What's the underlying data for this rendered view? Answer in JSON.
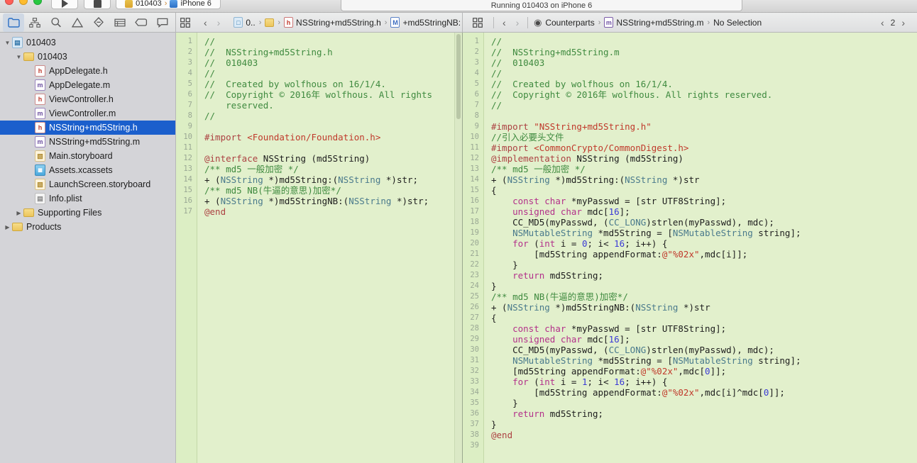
{
  "titlebar": {
    "run_label": "Run",
    "stop_label": "Stop",
    "scheme_name": "010403",
    "scheme_separator": "›",
    "device_name": "iPhone 6",
    "status_text": "Running 010403 on iPhone 6"
  },
  "navigator_icons": [
    {
      "name": "project-navigator-icon",
      "selected": true
    },
    {
      "name": "symbol-navigator-icon",
      "selected": false
    },
    {
      "name": "find-navigator-icon",
      "selected": false
    },
    {
      "name": "issue-navigator-icon",
      "selected": false
    },
    {
      "name": "test-navigator-icon",
      "selected": false
    },
    {
      "name": "debug-navigator-icon",
      "selected": false
    },
    {
      "name": "breakpoint-navigator-icon",
      "selected": false
    },
    {
      "name": "report-navigator-icon",
      "selected": false
    }
  ],
  "left_jumpbar": {
    "related_items_label": "Related Items",
    "back_label": "‹",
    "forward_label": "›",
    "crumbs": [
      {
        "label": "0..",
        "icon": "project-icon"
      },
      {
        "label": "",
        "icon": "folder-icon"
      },
      {
        "label": "NSString+md5String.h",
        "icon": "header-file-icon"
      },
      {
        "label": "+md5StringNB:",
        "icon": "method-icon"
      }
    ]
  },
  "right_jumpbar": {
    "back_label": "‹",
    "forward_label": "›",
    "crumbs": [
      {
        "label": "Counterparts",
        "icon": "counterparts-icon"
      },
      {
        "label": "NSString+md5String.m",
        "icon": "implementation-file-icon"
      },
      {
        "label": "No Selection",
        "icon": ""
      }
    ],
    "pager": {
      "prev": "‹",
      "count": "2",
      "next": "›"
    }
  },
  "sidebar": {
    "items": [
      {
        "label": "010403",
        "icon": "project-icon",
        "indent": 0,
        "twisty": "open",
        "selected": false
      },
      {
        "label": "010403",
        "icon": "folder-icon",
        "indent": 1,
        "twisty": "open",
        "selected": false
      },
      {
        "label": "AppDelegate.h",
        "icon": "header-file-icon",
        "indent": 2,
        "twisty": "none",
        "selected": false
      },
      {
        "label": "AppDelegate.m",
        "icon": "implementation-file-icon",
        "indent": 2,
        "twisty": "none",
        "selected": false
      },
      {
        "label": "ViewController.h",
        "icon": "header-file-icon",
        "indent": 2,
        "twisty": "none",
        "selected": false
      },
      {
        "label": "ViewController.m",
        "icon": "implementation-file-icon",
        "indent": 2,
        "twisty": "none",
        "selected": false
      },
      {
        "label": "NSString+md5String.h",
        "icon": "header-file-icon",
        "indent": 2,
        "twisty": "none",
        "selected": true
      },
      {
        "label": "NSString+md5String.m",
        "icon": "implementation-file-icon",
        "indent": 2,
        "twisty": "none",
        "selected": false
      },
      {
        "label": "Main.storyboard",
        "icon": "storyboard-icon",
        "indent": 2,
        "twisty": "none",
        "selected": false
      },
      {
        "label": "Assets.xcassets",
        "icon": "assets-icon",
        "indent": 2,
        "twisty": "none",
        "selected": false
      },
      {
        "label": "LaunchScreen.storyboard",
        "icon": "storyboard-icon",
        "indent": 2,
        "twisty": "none",
        "selected": false
      },
      {
        "label": "Info.plist",
        "icon": "plist-icon",
        "indent": 2,
        "twisty": "none",
        "selected": false
      },
      {
        "label": "Supporting Files",
        "icon": "folder-icon",
        "indent": 1,
        "twisty": "closed",
        "selected": false
      },
      {
        "label": "Products",
        "icon": "folder-icon",
        "indent": 0,
        "twisty": "closed",
        "selected": false
      }
    ]
  },
  "left_editor": {
    "file": "NSString+md5String.h",
    "line_count": 17,
    "lines": [
      {
        "n": 1,
        "tokens": [
          {
            "t": "//",
            "c": "c"
          }
        ]
      },
      {
        "n": 2,
        "tokens": [
          {
            "t": "//  NSString+md5String.h",
            "c": "c"
          }
        ]
      },
      {
        "n": 3,
        "tokens": [
          {
            "t": "//  010403",
            "c": "c"
          }
        ]
      },
      {
        "n": 4,
        "tokens": [
          {
            "t": "//",
            "c": "c"
          }
        ]
      },
      {
        "n": 5,
        "tokens": [
          {
            "t": "//  Created by wolfhous on 16/1/4.",
            "c": "c"
          }
        ]
      },
      {
        "n": 6,
        "wrapped": true,
        "tokens": [
          {
            "t": "//  Copyright © 2016年 wolfhous. All rights\n    reserved.",
            "c": "c"
          }
        ]
      },
      {
        "n": 7,
        "tokens": [
          {
            "t": "//",
            "c": "c"
          }
        ]
      },
      {
        "n": 8,
        "tokens": [
          {
            "t": "",
            "c": "pl"
          }
        ]
      },
      {
        "n": 9,
        "tokens": [
          {
            "t": "#import ",
            "c": "pre"
          },
          {
            "t": "<Foundation/Foundation.h>",
            "c": "str"
          }
        ]
      },
      {
        "n": 10,
        "tokens": [
          {
            "t": "",
            "c": "pl"
          }
        ]
      },
      {
        "n": 11,
        "tokens": [
          {
            "t": "@interface ",
            "c": "pre"
          },
          {
            "t": "NSString ",
            "c": "pl"
          },
          {
            "t": "(md5String)",
            "c": "pl"
          }
        ]
      },
      {
        "n": 12,
        "tokens": [
          {
            "t": "/** md5 一般加密 */",
            "c": "c"
          }
        ]
      },
      {
        "n": 13,
        "tokens": [
          {
            "t": "+ (",
            "c": "pl"
          },
          {
            "t": "NSString",
            "c": "ty"
          },
          {
            "t": " *)md5String:(",
            "c": "pl"
          },
          {
            "t": "NSString",
            "c": "ty"
          },
          {
            "t": " *)str;",
            "c": "pl"
          }
        ]
      },
      {
        "n": 14,
        "tokens": [
          {
            "t": "/** md5 NB(牛逼的意思)加密*/",
            "c": "c"
          }
        ]
      },
      {
        "n": 15,
        "tokens": [
          {
            "t": "+ (",
            "c": "pl"
          },
          {
            "t": "NSString",
            "c": "ty"
          },
          {
            "t": " *)md5StringNB:(",
            "c": "pl"
          },
          {
            "t": "NSString",
            "c": "ty"
          },
          {
            "t": " *)str;",
            "c": "pl"
          }
        ]
      },
      {
        "n": 16,
        "tokens": [
          {
            "t": "@end",
            "c": "pre"
          }
        ]
      },
      {
        "n": 17,
        "tokens": [
          {
            "t": "",
            "c": "pl"
          }
        ]
      }
    ]
  },
  "right_editor": {
    "file": "NSString+md5String.m",
    "line_count": 39,
    "lines": [
      {
        "n": 1,
        "tokens": [
          {
            "t": "//",
            "c": "c"
          }
        ]
      },
      {
        "n": 2,
        "tokens": [
          {
            "t": "//  NSString+md5String.m",
            "c": "c"
          }
        ]
      },
      {
        "n": 3,
        "tokens": [
          {
            "t": "//  010403",
            "c": "c"
          }
        ]
      },
      {
        "n": 4,
        "tokens": [
          {
            "t": "//",
            "c": "c"
          }
        ]
      },
      {
        "n": 5,
        "tokens": [
          {
            "t": "//  Created by wolfhous on 16/1/4.",
            "c": "c"
          }
        ]
      },
      {
        "n": 6,
        "tokens": [
          {
            "t": "//  Copyright © 2016年 wolfhous. All rights reserved.",
            "c": "c"
          }
        ]
      },
      {
        "n": 7,
        "tokens": [
          {
            "t": "//",
            "c": "c"
          }
        ]
      },
      {
        "n": 8,
        "tokens": [
          {
            "t": "",
            "c": "pl"
          }
        ]
      },
      {
        "n": 9,
        "tokens": [
          {
            "t": "#import ",
            "c": "pre"
          },
          {
            "t": "\"NSString+md5String.h\"",
            "c": "str"
          }
        ]
      },
      {
        "n": 10,
        "tokens": [
          {
            "t": "//引入必要头文件",
            "c": "c"
          }
        ]
      },
      {
        "n": 11,
        "tokens": [
          {
            "t": "#import ",
            "c": "pre"
          },
          {
            "t": "<CommonCrypto/CommonDigest.h>",
            "c": "str"
          }
        ]
      },
      {
        "n": 12,
        "tokens": [
          {
            "t": "@implementation ",
            "c": "pre"
          },
          {
            "t": "NSString (md5String)",
            "c": "pl"
          }
        ]
      },
      {
        "n": 13,
        "tokens": [
          {
            "t": "/** md5 一般加密 */",
            "c": "c"
          }
        ]
      },
      {
        "n": 14,
        "tokens": [
          {
            "t": "+ (",
            "c": "pl"
          },
          {
            "t": "NSString",
            "c": "ty"
          },
          {
            "t": " *)md5String:(",
            "c": "pl"
          },
          {
            "t": "NSString",
            "c": "ty"
          },
          {
            "t": " *)str",
            "c": "pl"
          }
        ]
      },
      {
        "n": 15,
        "tokens": [
          {
            "t": "{",
            "c": "pl"
          }
        ]
      },
      {
        "n": 16,
        "tokens": [
          {
            "t": "    ",
            "c": "pl"
          },
          {
            "t": "const char",
            "c": "kw"
          },
          {
            "t": " *myPasswd = [str UTF8String];",
            "c": "pl"
          }
        ]
      },
      {
        "n": 17,
        "tokens": [
          {
            "t": "    ",
            "c": "pl"
          },
          {
            "t": "unsigned char",
            "c": "kw"
          },
          {
            "t": " mdc[",
            "c": "pl"
          },
          {
            "t": "16",
            "c": "num"
          },
          {
            "t": "];",
            "c": "pl"
          }
        ]
      },
      {
        "n": 18,
        "tokens": [
          {
            "t": "    CC_MD5(myPasswd, (",
            "c": "pl"
          },
          {
            "t": "CC_LONG",
            "c": "ty"
          },
          {
            "t": ")strlen(myPasswd), mdc);",
            "c": "pl"
          }
        ]
      },
      {
        "n": 19,
        "tokens": [
          {
            "t": "    ",
            "c": "pl"
          },
          {
            "t": "NSMutableString",
            "c": "ty"
          },
          {
            "t": " *md5String = [",
            "c": "pl"
          },
          {
            "t": "NSMutableString",
            "c": "ty"
          },
          {
            "t": " string];",
            "c": "pl"
          }
        ]
      },
      {
        "n": 20,
        "tokens": [
          {
            "t": "    ",
            "c": "pl"
          },
          {
            "t": "for",
            "c": "kw"
          },
          {
            "t": " (",
            "c": "pl"
          },
          {
            "t": "int",
            "c": "kw"
          },
          {
            "t": " i = ",
            "c": "pl"
          },
          {
            "t": "0",
            "c": "num"
          },
          {
            "t": "; i< ",
            "c": "pl"
          },
          {
            "t": "16",
            "c": "num"
          },
          {
            "t": "; i++) {",
            "c": "pl"
          }
        ]
      },
      {
        "n": 21,
        "tokens": [
          {
            "t": "        [md5String appendFormat:",
            "c": "pl"
          },
          {
            "t": "@\"%02x\"",
            "c": "str"
          },
          {
            "t": ",mdc[i]];",
            "c": "pl"
          }
        ]
      },
      {
        "n": 22,
        "tokens": [
          {
            "t": "    }",
            "c": "pl"
          }
        ]
      },
      {
        "n": 23,
        "tokens": [
          {
            "t": "    ",
            "c": "pl"
          },
          {
            "t": "return",
            "c": "kw"
          },
          {
            "t": " md5String;",
            "c": "pl"
          }
        ]
      },
      {
        "n": 24,
        "tokens": [
          {
            "t": "}",
            "c": "pl"
          }
        ]
      },
      {
        "n": 25,
        "tokens": [
          {
            "t": "/** md5 NB(牛逼的意思)加密*/",
            "c": "c"
          }
        ]
      },
      {
        "n": 26,
        "tokens": [
          {
            "t": "+ (",
            "c": "pl"
          },
          {
            "t": "NSString",
            "c": "ty"
          },
          {
            "t": " *)md5StringNB:(",
            "c": "pl"
          },
          {
            "t": "NSString",
            "c": "ty"
          },
          {
            "t": " *)str",
            "c": "pl"
          }
        ]
      },
      {
        "n": 27,
        "tokens": [
          {
            "t": "{",
            "c": "pl"
          }
        ]
      },
      {
        "n": 28,
        "tokens": [
          {
            "t": "    ",
            "c": "pl"
          },
          {
            "t": "const char",
            "c": "kw"
          },
          {
            "t": " *myPasswd = [str UTF8String];",
            "c": "pl"
          }
        ]
      },
      {
        "n": 29,
        "tokens": [
          {
            "t": "    ",
            "c": "pl"
          },
          {
            "t": "unsigned char",
            "c": "kw"
          },
          {
            "t": " mdc[",
            "c": "pl"
          },
          {
            "t": "16",
            "c": "num"
          },
          {
            "t": "];",
            "c": "pl"
          }
        ]
      },
      {
        "n": 30,
        "tokens": [
          {
            "t": "    CC_MD5(myPasswd, (",
            "c": "pl"
          },
          {
            "t": "CC_LONG",
            "c": "ty"
          },
          {
            "t": ")strlen(myPasswd), mdc);",
            "c": "pl"
          }
        ]
      },
      {
        "n": 31,
        "tokens": [
          {
            "t": "    ",
            "c": "pl"
          },
          {
            "t": "NSMutableString",
            "c": "ty"
          },
          {
            "t": " *md5String = [",
            "c": "pl"
          },
          {
            "t": "NSMutableString",
            "c": "ty"
          },
          {
            "t": " string];",
            "c": "pl"
          }
        ]
      },
      {
        "n": 32,
        "tokens": [
          {
            "t": "    [md5String appendFormat:",
            "c": "pl"
          },
          {
            "t": "@\"%02x\"",
            "c": "str"
          },
          {
            "t": ",mdc[",
            "c": "pl"
          },
          {
            "t": "0",
            "c": "num"
          },
          {
            "t": "]];",
            "c": "pl"
          }
        ]
      },
      {
        "n": 33,
        "tokens": [
          {
            "t": "    ",
            "c": "pl"
          },
          {
            "t": "for",
            "c": "kw"
          },
          {
            "t": " (",
            "c": "pl"
          },
          {
            "t": "int",
            "c": "kw"
          },
          {
            "t": " i = ",
            "c": "pl"
          },
          {
            "t": "1",
            "c": "num"
          },
          {
            "t": "; i< ",
            "c": "pl"
          },
          {
            "t": "16",
            "c": "num"
          },
          {
            "t": "; i++) {",
            "c": "pl"
          }
        ]
      },
      {
        "n": 34,
        "tokens": [
          {
            "t": "        [md5String appendFormat:",
            "c": "pl"
          },
          {
            "t": "@\"%02x\"",
            "c": "str"
          },
          {
            "t": ",mdc[i]^mdc[",
            "c": "pl"
          },
          {
            "t": "0",
            "c": "num"
          },
          {
            "t": "]];",
            "c": "pl"
          }
        ]
      },
      {
        "n": 35,
        "tokens": [
          {
            "t": "    }",
            "c": "pl"
          }
        ]
      },
      {
        "n": 36,
        "tokens": [
          {
            "t": "    ",
            "c": "pl"
          },
          {
            "t": "return",
            "c": "kw"
          },
          {
            "t": " md5String;",
            "c": "pl"
          }
        ]
      },
      {
        "n": 37,
        "tokens": [
          {
            "t": "}",
            "c": "pl"
          }
        ]
      },
      {
        "n": 38,
        "tokens": [
          {
            "t": "@end",
            "c": "pre"
          }
        ]
      },
      {
        "n": 39,
        "tokens": [
          {
            "t": "",
            "c": "pl"
          }
        ]
      }
    ]
  },
  "colors": {
    "editor_background": "#e2f0cc",
    "gutter_background": "#dceec4",
    "sidebar_background": "#d4d4d8",
    "selection_blue": "#1b5fcc",
    "comment_green": "#3f8a3f",
    "keyword_magenta": "#b3308a",
    "string_red": "#c0392b",
    "type_teal": "#4a7a8c",
    "number_blue": "#3a3ad6",
    "preprocessor_red": "#ac4142"
  }
}
